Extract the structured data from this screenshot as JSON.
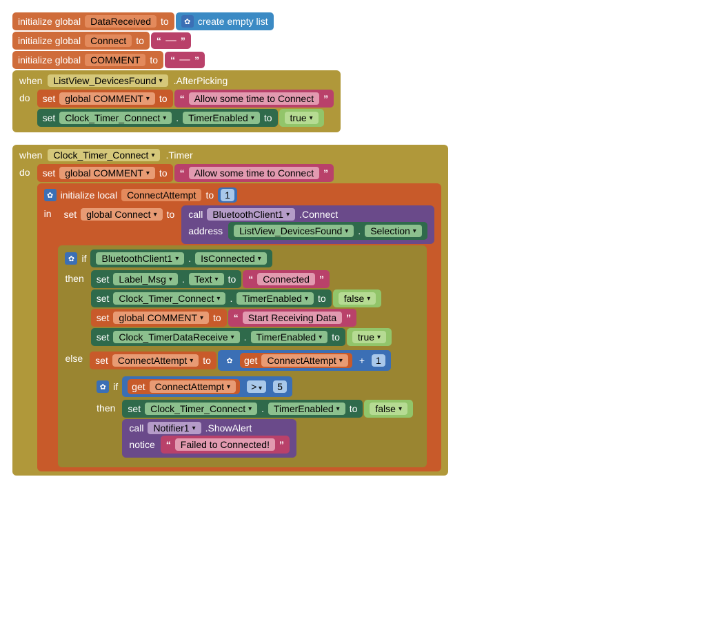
{
  "init1": {
    "label_prefix": "initialize global",
    "var": "DataReceived",
    "label_to": "to",
    "value_label": "create empty list"
  },
  "init2": {
    "label_prefix": "initialize global",
    "var": "Connect",
    "label_to": "to",
    "value": ""
  },
  "init3": {
    "label_prefix": "initialize global",
    "var": "COMMENT",
    "label_to": "to",
    "value": ""
  },
  "when1": {
    "keyword_when": "when",
    "component": "ListView_DevicesFound",
    "event": ".AfterPicking",
    "keyword_do": "do",
    "set1": {
      "kw_set": "set",
      "var": "global COMMENT",
      "kw_to": "to",
      "text": "Allow some time to Connect"
    },
    "set2": {
      "kw_set": "set",
      "comp": "Clock_Timer_Connect",
      "dot": ".",
      "prop": "TimerEnabled",
      "kw_to": "to",
      "val": "true"
    }
  },
  "when2": {
    "keyword_when": "when",
    "component": "Clock_Timer_Connect",
    "event": ".Timer",
    "keyword_do": "do",
    "set_comment": {
      "kw_set": "set",
      "var": "global COMMENT",
      "kw_to": "to",
      "text": "Allow some time to Connect"
    },
    "local": {
      "kw": "initialize local",
      "var": "ConnectAttempt",
      "kw_to": "to",
      "num": "1",
      "kw_in": "in",
      "set_connect": {
        "kw_set": "set",
        "var": "global Connect",
        "kw_to": "to",
        "call": "call",
        "comp": "BluetoothClient1",
        "method": ".Connect",
        "arg_label": "address",
        "arg_comp": "ListView_DevicesFound",
        "dot": ".",
        "arg_prop": "Selection"
      },
      "if1": {
        "kw_if": "if",
        "cond_comp": "BluetoothClient1",
        "dot": ".",
        "cond_prop": "IsConnected",
        "kw_then": "then",
        "then1": {
          "kw_set": "set",
          "comp": "Label_Msg",
          "dot": ".",
          "prop": "Text",
          "kw_to": "to",
          "text": "Connected"
        },
        "then2": {
          "kw_set": "set",
          "comp": "Clock_Timer_Connect",
          "dot": ".",
          "prop": "TimerEnabled",
          "kw_to": "to",
          "val": "false"
        },
        "then3": {
          "kw_set": "set",
          "var": "global COMMENT",
          "kw_to": "to",
          "text": "Start Receiving Data"
        },
        "then4": {
          "kw_set": "set",
          "comp": "Clock_TimerDataReceive",
          "dot": ".",
          "prop": "TimerEnabled",
          "kw_to": "to",
          "val": "true"
        },
        "kw_else": "else",
        "else1": {
          "kw_set": "set",
          "var": "ConnectAttempt",
          "kw_to": "to",
          "kw_get": "get",
          "gvar": "ConnectAttempt",
          "op": "+",
          "num": "1"
        },
        "if2": {
          "kw_if": "if",
          "kw_get": "get",
          "gvar": "ConnectAttempt",
          "op": ">",
          "num": "5",
          "kw_then": "then",
          "then1": {
            "kw_set": "set",
            "comp": "Clock_Timer_Connect",
            "dot": ".",
            "prop": "TimerEnabled",
            "kw_to": "to",
            "val": "false"
          },
          "call": {
            "kw": "call",
            "comp": "Notifier1",
            "method": ".ShowAlert",
            "arg_label": "notice",
            "text": "Failed to Connected!"
          }
        }
      }
    }
  }
}
